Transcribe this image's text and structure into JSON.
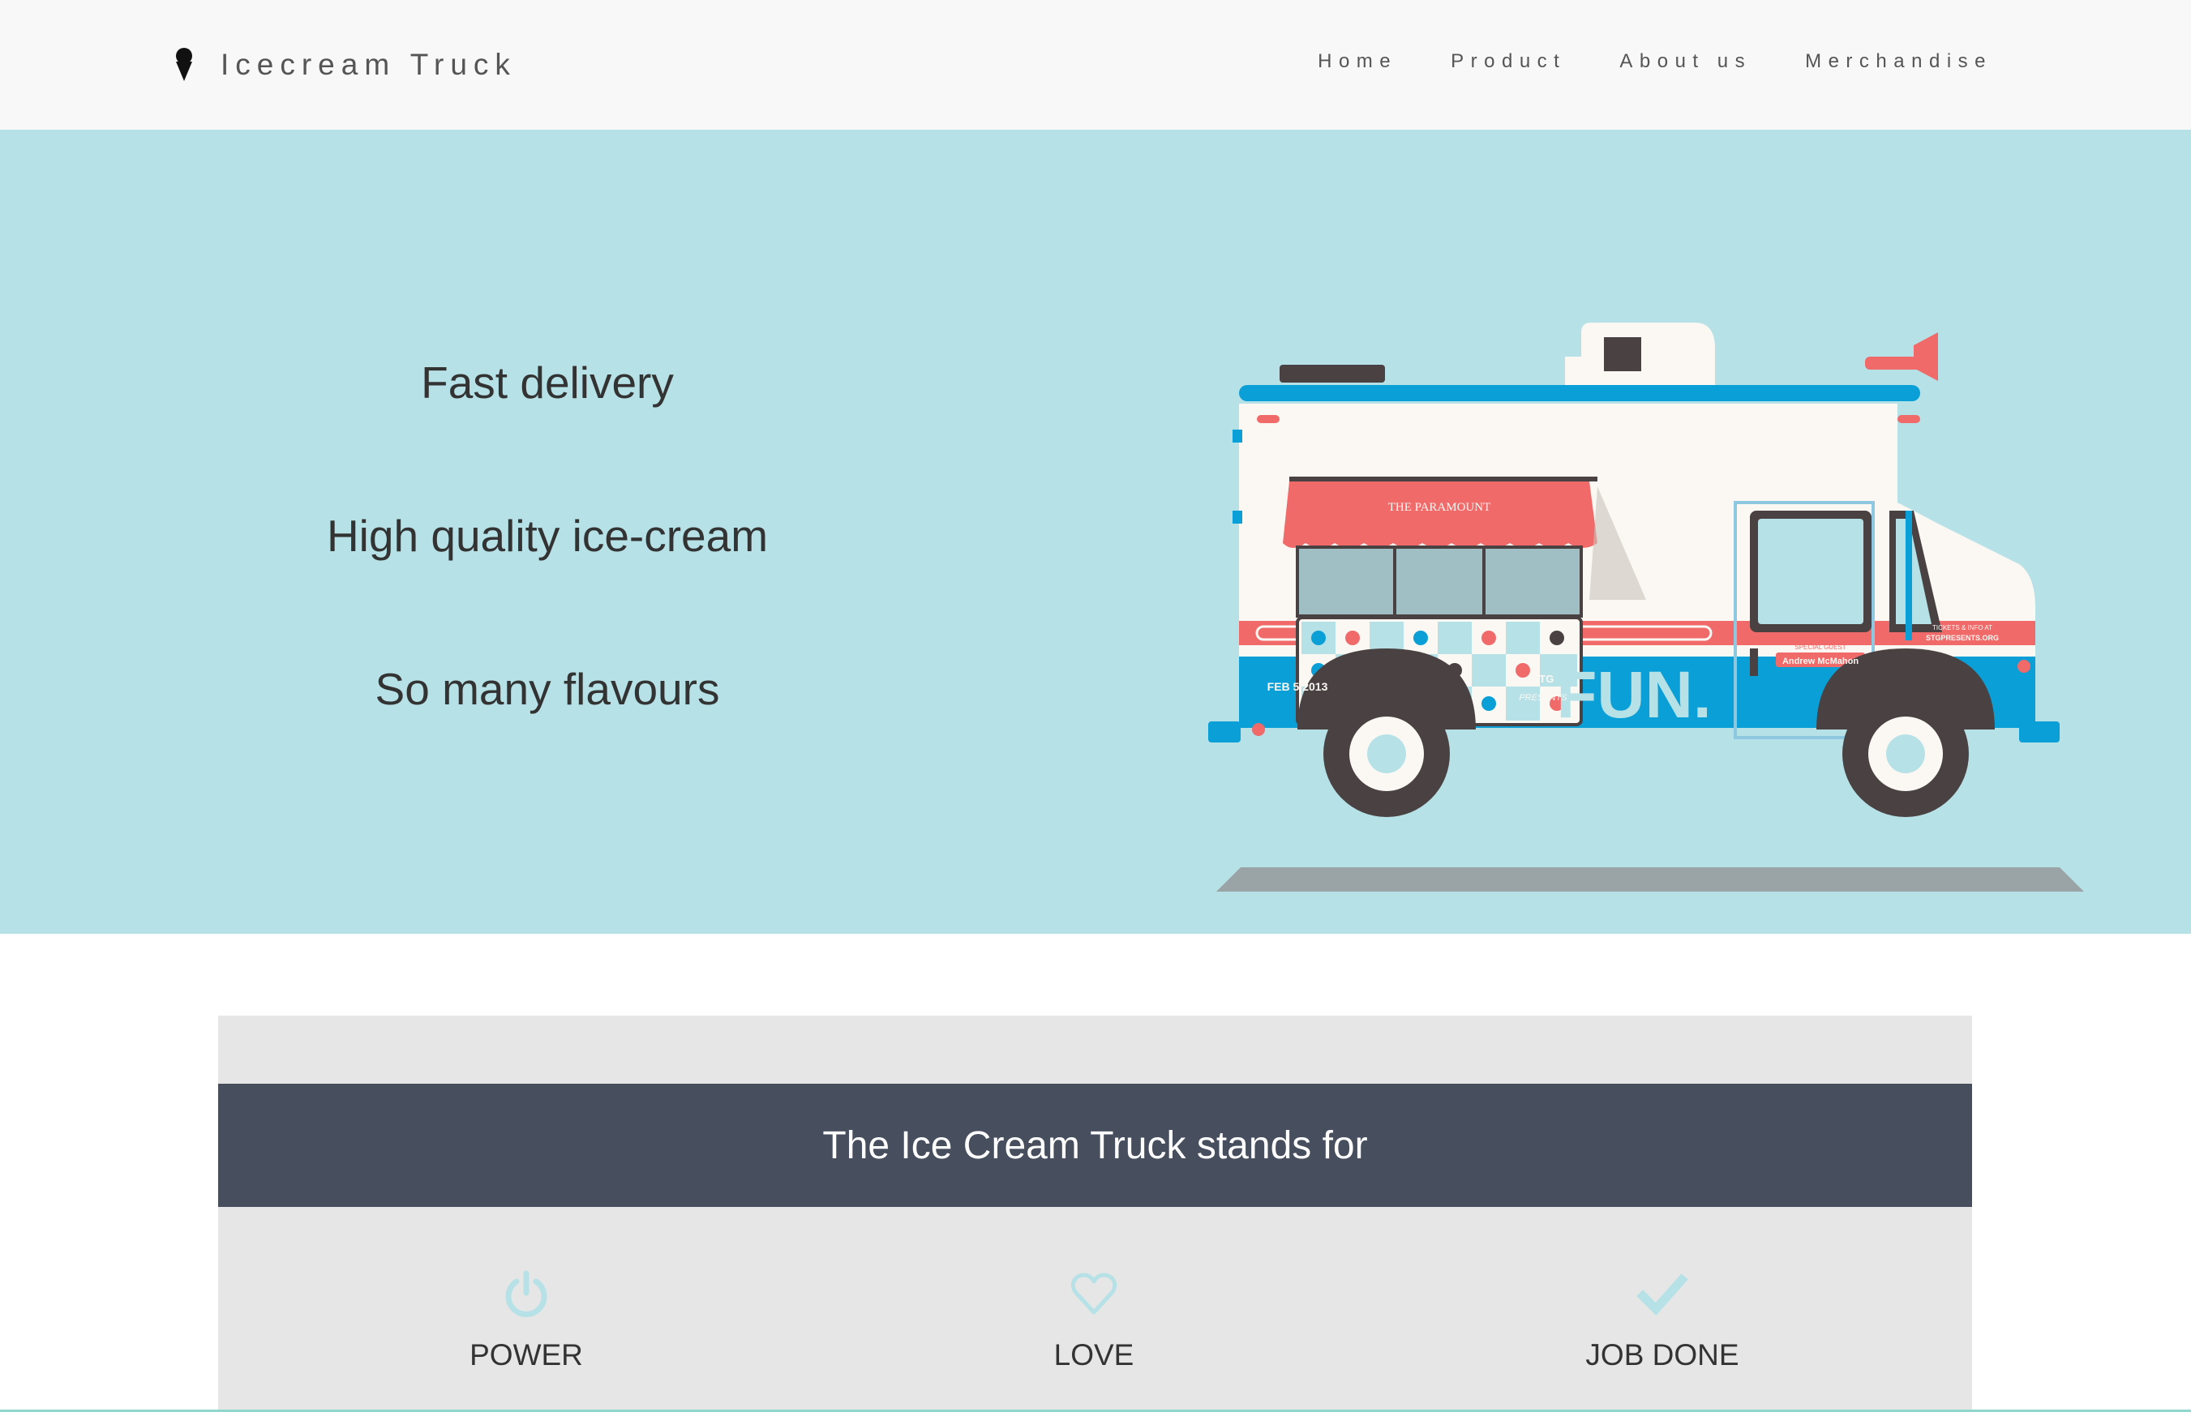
{
  "header": {
    "brand": {
      "icon": "ice-cream-cone-icon",
      "name": "Icecream Truck"
    },
    "nav": [
      "Home",
      "Product",
      "About us",
      "Merchandise"
    ]
  },
  "hero": {
    "features": [
      "Fast delivery",
      "High quality ice-cream",
      "So many flavours"
    ],
    "truck": {
      "awning_text": "THE PARAMOUNT",
      "side_text": "FUN.",
      "date_text": "FEB 5 2013",
      "logo_text": "STG",
      "presents_text": "PRESENTS",
      "guest_label": "SPECIAL GUEST",
      "guest_name": "Andrew McMahon",
      "tickets_label": "TICKETS & INFO AT",
      "tickets_url": "STGPRESENTS.ORG"
    }
  },
  "values": {
    "heading": "The Ice Cream Truck stands for",
    "items": [
      {
        "icon": "power-icon",
        "label": "POWER"
      },
      {
        "icon": "heart-icon",
        "label": "LOVE"
      },
      {
        "icon": "checkmark-icon",
        "label": "JOB DONE"
      }
    ]
  },
  "colors": {
    "header_bg": "#f8f8f8",
    "hero_bg": "#b6e1e6",
    "panel_bg": "#e6e6e6",
    "band_bg": "#474e5d",
    "icon_accent": "#b6e1e6",
    "truck_blue": "#0a9fd6",
    "truck_red": "#f06a6a"
  }
}
